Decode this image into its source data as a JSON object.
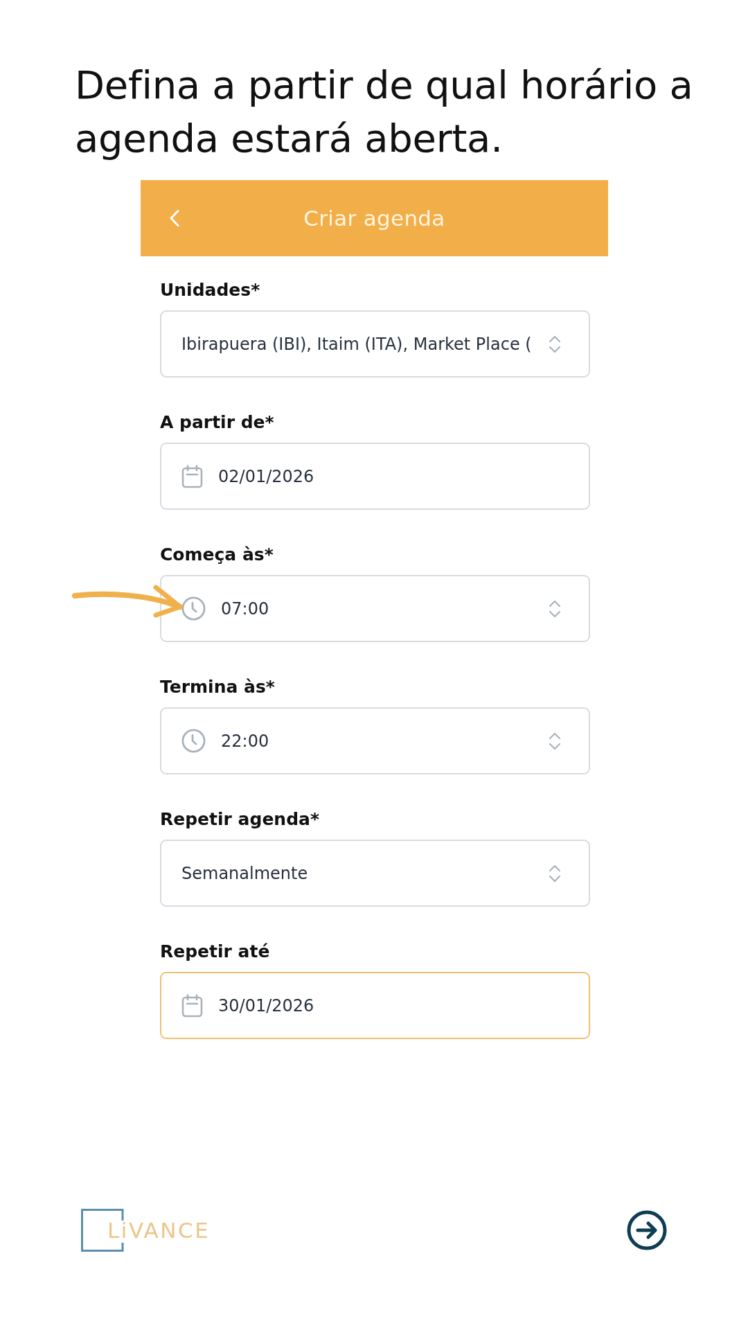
{
  "heading": "Defina a partir de qual horário a agenda estará aberta.",
  "screen": {
    "title": "Criar agenda"
  },
  "fields": [
    {
      "label": "Unidades*",
      "kind": "select",
      "value": "Ibirapuera (IBI), Itaim (ITA), Market Place (",
      "focused": false,
      "pointed": false
    },
    {
      "label": "A partir de*",
      "kind": "date",
      "value": "02/01/2026",
      "focused": false,
      "pointed": false
    },
    {
      "label": "Começa às*",
      "kind": "time",
      "value": "07:00",
      "focused": false,
      "pointed": true
    },
    {
      "label": "Termina às*",
      "kind": "time",
      "value": "22:00",
      "focused": false,
      "pointed": false
    },
    {
      "label": "Repetir agenda*",
      "kind": "select",
      "value": "Semanalmente",
      "focused": false,
      "pointed": false
    },
    {
      "label": "Repetir até",
      "kind": "date",
      "value": "30/01/2026",
      "focused": true,
      "pointed": false
    }
  ],
  "logo": {
    "text": "LiVANCE"
  }
}
